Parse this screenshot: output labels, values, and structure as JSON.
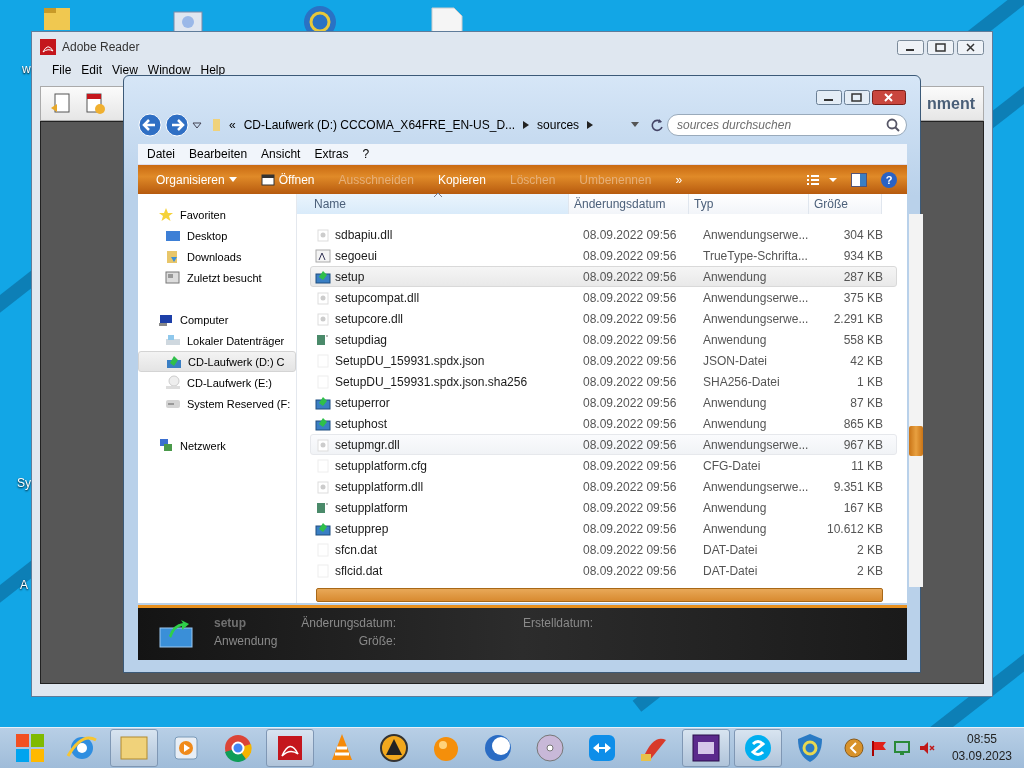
{
  "desktop": {
    "labels": [
      "w",
      "Sy",
      "A"
    ]
  },
  "reader": {
    "title": "Adobe Reader",
    "menu": [
      "File",
      "Edit",
      "View",
      "Window",
      "Help"
    ],
    "toolbar_text": "nment"
  },
  "explorer": {
    "address": {
      "overflow": "«",
      "segments": [
        "CD-Laufwerk (D:) CCCOMA_X64FRE_EN-US_D...",
        "sources"
      ]
    },
    "search": {
      "placeholder": "sources durchsuchen"
    },
    "menu": [
      "Datei",
      "Bearbeiten",
      "Ansicht",
      "Extras",
      "?"
    ],
    "toolbar": [
      {
        "label": "Organisieren",
        "kind": "dropdown",
        "disabled": false
      },
      {
        "label": "Öffnen",
        "kind": "open",
        "disabled": false
      },
      {
        "label": "Ausschneiden",
        "kind": "plain",
        "disabled": true
      },
      {
        "label": "Kopieren",
        "kind": "plain",
        "disabled": false
      },
      {
        "label": "Löschen",
        "kind": "plain",
        "disabled": true
      },
      {
        "label": "Umbenennen",
        "kind": "plain",
        "disabled": true
      },
      {
        "label": "»",
        "kind": "plain",
        "disabled": false
      }
    ],
    "nav": [
      {
        "label": "Favoriten",
        "kind": "star",
        "children": [
          {
            "label": "Desktop",
            "kind": "desktop",
            "selected": false
          },
          {
            "label": "Downloads",
            "kind": "downloads",
            "selected": false
          },
          {
            "label": "Zuletzt besucht",
            "kind": "recent",
            "selected": false
          }
        ]
      },
      {
        "label": "Computer",
        "kind": "computer",
        "children": [
          {
            "label": "Lokaler Datenträger",
            "kind": "disk",
            "selected": false
          },
          {
            "label": "CD-Laufwerk (D:) C",
            "kind": "cd",
            "selected": true
          },
          {
            "label": "CD-Laufwerk (E:)",
            "kind": "cdempty",
            "selected": false
          },
          {
            "label": "System Reserved (F:",
            "kind": "drive",
            "selected": false
          }
        ]
      },
      {
        "label": "Netzwerk",
        "kind": "network"
      }
    ],
    "help_label": "?",
    "columns": [
      "Name",
      "Änderungsdatum",
      "Typ",
      "Größe"
    ],
    "rows": [
      {
        "name": "sdbapiu.dll",
        "date": "08.09.2022 09:56",
        "type": "Anwendungserwe...",
        "size": "304 KB",
        "kind": "dll",
        "selected": false,
        "hovered": false
      },
      {
        "name": "segoeui",
        "date": "08.09.2022 09:56",
        "type": "TrueType-Schrifta...",
        "size": "934 KB",
        "kind": "font",
        "selected": false,
        "hovered": false
      },
      {
        "name": "setup",
        "date": "08.09.2022 09:56",
        "type": "Anwendung",
        "size": "287 KB",
        "kind": "app",
        "selected": true,
        "hovered": false
      },
      {
        "name": "setupcompat.dll",
        "date": "08.09.2022 09:56",
        "type": "Anwendungserwe...",
        "size": "375 KB",
        "kind": "dll",
        "selected": false,
        "hovered": false
      },
      {
        "name": "setupcore.dll",
        "date": "08.09.2022 09:56",
        "type": "Anwendungserwe...",
        "size": "2.291 KB",
        "kind": "dll",
        "selected": false,
        "hovered": false
      },
      {
        "name": "setupdiag",
        "date": "08.09.2022 09:56",
        "type": "Anwendung",
        "size": "558 KB",
        "kind": "diag",
        "selected": false,
        "hovered": false
      },
      {
        "name": "SetupDU_159931.spdx.json",
        "date": "08.09.2022 09:56",
        "type": "JSON-Datei",
        "size": "42 KB",
        "kind": "file",
        "selected": false,
        "hovered": false
      },
      {
        "name": "SetupDU_159931.spdx.json.sha256",
        "date": "08.09.2022 09:56",
        "type": "SHA256-Datei",
        "size": "1 KB",
        "kind": "file",
        "selected": false,
        "hovered": false
      },
      {
        "name": "setuperror",
        "date": "08.09.2022 09:56",
        "type": "Anwendung",
        "size": "87 KB",
        "kind": "app",
        "selected": false,
        "hovered": false
      },
      {
        "name": "setuphost",
        "date": "08.09.2022 09:56",
        "type": "Anwendung",
        "size": "865 KB",
        "kind": "app",
        "selected": false,
        "hovered": false
      },
      {
        "name": "setupmgr.dll",
        "date": "08.09.2022 09:56",
        "type": "Anwendungserwe...",
        "size": "967 KB",
        "kind": "dll",
        "selected": false,
        "hovered": true
      },
      {
        "name": "setupplatform.cfg",
        "date": "08.09.2022 09:56",
        "type": "CFG-Datei",
        "size": "11 KB",
        "kind": "file",
        "selected": false,
        "hovered": false
      },
      {
        "name": "setupplatform.dll",
        "date": "08.09.2022 09:56",
        "type": "Anwendungserwe...",
        "size": "9.351 KB",
        "kind": "dll",
        "selected": false,
        "hovered": false
      },
      {
        "name": "setupplatform",
        "date": "08.09.2022 09:56",
        "type": "Anwendung",
        "size": "167 KB",
        "kind": "diag",
        "selected": false,
        "hovered": false
      },
      {
        "name": "setupprep",
        "date": "08.09.2022 09:56",
        "type": "Anwendung",
        "size": "10.612 KB",
        "kind": "app",
        "selected": false,
        "hovered": false
      },
      {
        "name": "sfcn.dat",
        "date": "08.09.2022 09:56",
        "type": "DAT-Datei",
        "size": "2 KB",
        "kind": "file",
        "selected": false,
        "hovered": false
      },
      {
        "name": "sflcid.dat",
        "date": "08.09.2022 09:56",
        "type": "DAT-Datei",
        "size": "2 KB",
        "kind": "file",
        "selected": false,
        "hovered": false
      }
    ],
    "details": {
      "name": "setup",
      "type": "Anwendung",
      "modified_label": "Änderungsdatum:",
      "size_label": "Größe:",
      "created_label": "Erstelldatum:"
    }
  },
  "taskbar": {
    "items": [
      {
        "kind": "windows",
        "active": false
      },
      {
        "kind": "ie",
        "active": false
      },
      {
        "kind": "folder",
        "active": true
      },
      {
        "kind": "player",
        "active": false
      },
      {
        "kind": "chrome",
        "active": false
      },
      {
        "kind": "pdf",
        "active": true
      },
      {
        "kind": "cone",
        "active": false
      },
      {
        "kind": "triangle",
        "active": false
      },
      {
        "kind": "orb",
        "active": false
      },
      {
        "kind": "moon",
        "active": false
      },
      {
        "kind": "disc",
        "active": false
      },
      {
        "kind": "remote",
        "active": false
      },
      {
        "kind": "brush",
        "active": false
      },
      {
        "kind": "chip",
        "active": true
      },
      {
        "kind": "skype",
        "active": true
      },
      {
        "kind": "shield",
        "active": false
      }
    ],
    "time": "08:55",
    "date": "03.09.2023"
  }
}
